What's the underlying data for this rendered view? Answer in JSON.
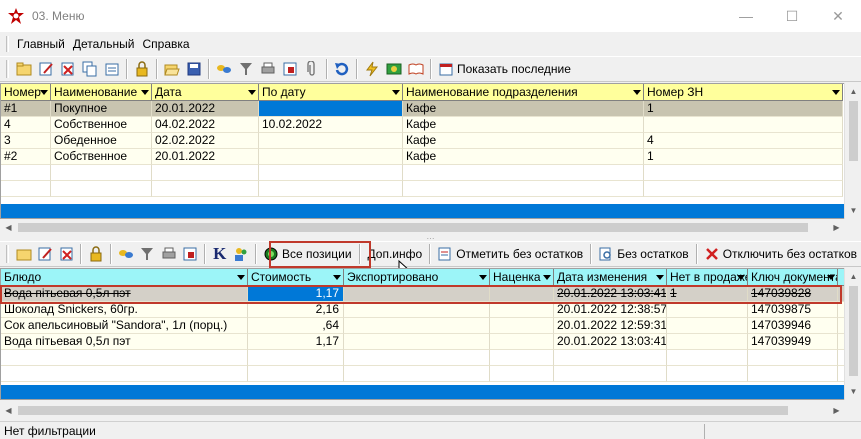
{
  "window": {
    "title": "03. Меню",
    "minimize": "—",
    "maximize": "☐",
    "close": "✕"
  },
  "menu": [
    "Главный",
    "Детальный",
    "Справка"
  ],
  "toolbar_top": {
    "show_last_label": "Показать последние"
  },
  "top_grid": {
    "columns": [
      {
        "label": "Номер",
        "w": 50
      },
      {
        "label": "Наименование",
        "w": 101
      },
      {
        "label": "Дата",
        "w": 107
      },
      {
        "label": "По дату",
        "w": 144
      },
      {
        "label": "Наименование подразделения",
        "w": 241
      },
      {
        "label": "Номер ЗН",
        "w": 199
      }
    ],
    "rows": [
      [
        "#1",
        "Покупное",
        "20.01.2022",
        "",
        "Кафе",
        "1"
      ],
      [
        "4",
        "Собственное",
        "04.02.2022",
        "10.02.2022",
        "Кафе",
        ""
      ],
      [
        "3",
        "Обеденное",
        "02.02.2022",
        "",
        "Кафе",
        "4"
      ],
      [
        "#2",
        "Собственное",
        "20.01.2022",
        "",
        "Кафе",
        "1"
      ]
    ]
  },
  "toolbar_bottom": {
    "all_positions": "Все позиции",
    "extra_info": "Доп.инфо",
    "mark_no_stock": "Отметить без остатков",
    "no_stock": "Без остатков",
    "disable_no_stock": "Отключить без остатков",
    "k_label": "K"
  },
  "bottom_grid": {
    "columns": [
      {
        "label": "Блюдо",
        "w": 247
      },
      {
        "label": "Стоимость",
        "w": 96
      },
      {
        "label": "Экспортировано",
        "w": 146
      },
      {
        "label": "Наценка",
        "w": 64
      },
      {
        "label": "Дата изменения",
        "w": 113
      },
      {
        "label": "Нет в продаже",
        "w": 81
      },
      {
        "label": "Ключ документа",
        "w": 90
      },
      {
        "label": "",
        "w": 20
      }
    ],
    "rows": [
      [
        "Вода пітьевая 0,5л пэт",
        "1,17",
        "",
        "",
        "20.01.2022 13:03:41",
        "1",
        "147039828"
      ],
      [
        "Шоколад Snickers, 60гр.",
        "2,16",
        "",
        "",
        "20.01.2022 12:38:57",
        "",
        "147039875"
      ],
      [
        "Сок апельсиновый \"Sandora\", 1л (порц.)",
        ",64",
        "",
        "",
        "20.01.2022 12:59:31",
        "",
        "147039946"
      ],
      [
        "Вода пітьевая 0,5л пэт",
        "1,17",
        "",
        "",
        "20.01.2022 13:03:41",
        "",
        "147039949"
      ]
    ]
  },
  "status": {
    "filter_text": "Нет фильтрации"
  },
  "colors": {
    "header_top": "#ffff9c",
    "header_bottom": "#9cf5f8",
    "row_selected_top": "#c8c4b0",
    "row_alt": "#fffff0",
    "cell_blue": "#0078d7",
    "accent_red": "#c0392b"
  }
}
